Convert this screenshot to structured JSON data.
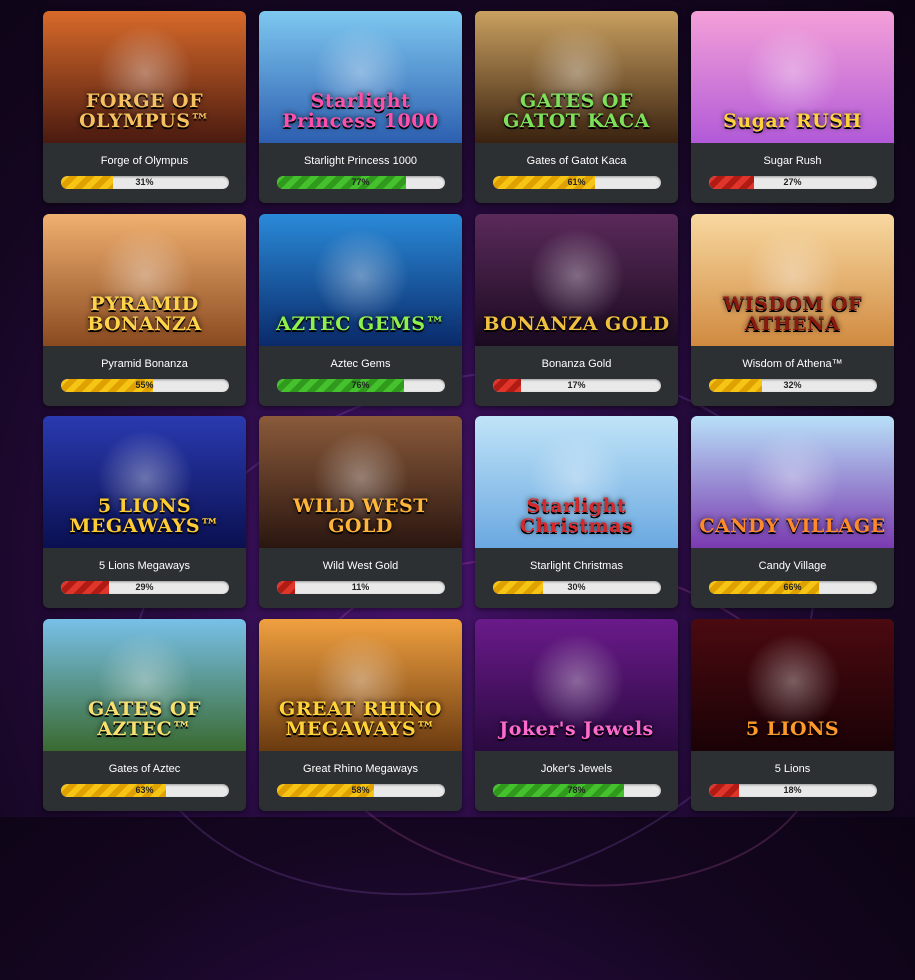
{
  "games": [
    {
      "name": "Forge of Olympus",
      "logo": "FORGE OF OLYMPUS™",
      "percent": 31,
      "percent_label": "31%",
      "level": "yellow",
      "art_top": "#d86a2a",
      "art_bottom": "#4a1a10",
      "logo_color": "#f4c060"
    },
    {
      "name": "Starlight Princess 1000",
      "logo": "Starlight Princess 1000",
      "percent": 77,
      "percent_label": "77%",
      "level": "green",
      "art_top": "#7ec8f0",
      "art_bottom": "#2d5fb0",
      "logo_color": "#ff4fa8"
    },
    {
      "name": "Gates of Gatot Kaca",
      "logo": "GATES OF GATOT KACA",
      "percent": 61,
      "percent_label": "61%",
      "level": "yellow",
      "art_top": "#c9a060",
      "art_bottom": "#3a2210",
      "logo_color": "#7ee05a"
    },
    {
      "name": "Sugar Rush",
      "logo": "Sugar RUSH",
      "percent": 27,
      "percent_label": "27%",
      "level": "red",
      "art_top": "#f4a0d8",
      "art_bottom": "#b25ad8",
      "logo_color": "#ffd23a"
    },
    {
      "name": "Pyramid Bonanza",
      "logo": "PYRAMID BONANZA",
      "percent": 55,
      "percent_label": "55%",
      "level": "yellow",
      "art_top": "#f0b070",
      "art_bottom": "#8a4a20",
      "logo_color": "#ffd34a"
    },
    {
      "name": "Aztec Gems",
      "logo": "AZTEC GEMS™",
      "percent": 76,
      "percent_label": "76%",
      "level": "green",
      "art_top": "#2a8ad8",
      "art_bottom": "#0a2a6a",
      "logo_color": "#8ef04a"
    },
    {
      "name": "Bonanza Gold",
      "logo": "BONANZA GOLD",
      "percent": 17,
      "percent_label": "17%",
      "level": "red",
      "art_top": "#5a2a5a",
      "art_bottom": "#1a0a20",
      "logo_color": "#f0c040"
    },
    {
      "name": "Wisdom of Athena™",
      "logo": "WISDOM OF ATHENA",
      "percent": 32,
      "percent_label": "32%",
      "level": "yellow",
      "art_top": "#f8d8a0",
      "art_bottom": "#d08a40",
      "logo_color": "#8a1a10"
    },
    {
      "name": "5 Lions Megaways",
      "logo": "5 LIONS MEGAWAYS™",
      "percent": 29,
      "percent_label": "29%",
      "level": "red",
      "art_top": "#2a3ab0",
      "art_bottom": "#0a1050",
      "logo_color": "#ffcc33"
    },
    {
      "name": "Wild West Gold",
      "logo": "WILD WEST GOLD",
      "percent": 11,
      "percent_label": "11%",
      "level": "red",
      "art_top": "#8a5a3a",
      "art_bottom": "#2a1610",
      "logo_color": "#ffb43a"
    },
    {
      "name": "Starlight Christmas",
      "logo": "Starlight Christmas",
      "percent": 30,
      "percent_label": "30%",
      "level": "yellow",
      "art_top": "#c0e4f8",
      "art_bottom": "#6aa8e0",
      "logo_color": "#d8282a"
    },
    {
      "name": "Candy Village",
      "logo": "CANDY VILLAGE",
      "percent": 66,
      "percent_label": "66%",
      "level": "yellow",
      "art_top": "#b8e0f8",
      "art_bottom": "#7a3ab0",
      "logo_color": "#ff8a2a"
    },
    {
      "name": "Gates of Aztec",
      "logo": "GATES OF AZTEC™",
      "percent": 63,
      "percent_label": "63%",
      "level": "yellow",
      "art_top": "#78c0e8",
      "art_bottom": "#3a6a30",
      "logo_color": "#f8e070"
    },
    {
      "name": "Great Rhino Megaways",
      "logo": "GREAT RHINO MEGAWAYS™",
      "percent": 58,
      "percent_label": "58%",
      "level": "yellow",
      "art_top": "#f0a040",
      "art_bottom": "#6a3a10",
      "logo_color": "#ffd23a"
    },
    {
      "name": "Joker's Jewels",
      "logo": "Joker's Jewels",
      "percent": 78,
      "percent_label": "78%",
      "level": "green",
      "art_top": "#6a1a8a",
      "art_bottom": "#2a0a40",
      "logo_color": "#ff6ad0"
    },
    {
      "name": "5 Lions",
      "logo": "5 LIONS",
      "percent": 18,
      "percent_label": "18%",
      "level": "red",
      "art_top": "#4a0a10",
      "art_bottom": "#1a0206",
      "logo_color": "#ff9a2a"
    }
  ]
}
